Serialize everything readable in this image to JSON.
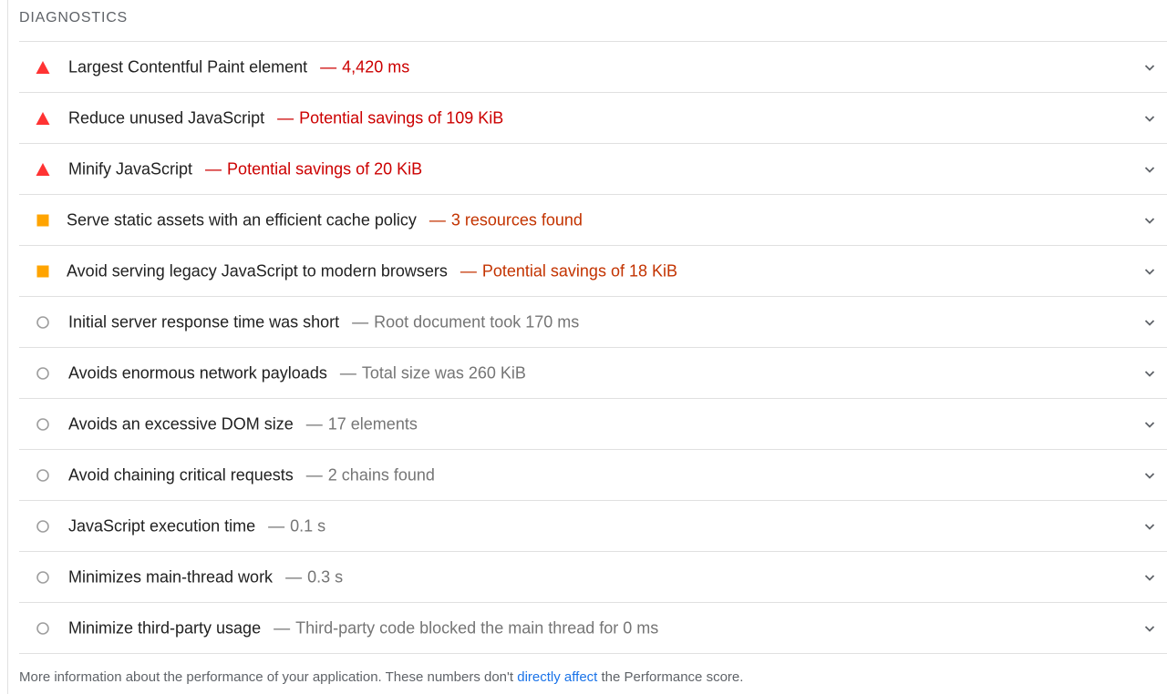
{
  "section": {
    "title": "DIAGNOSTICS"
  },
  "colors": {
    "fail": "#ff3333",
    "warn": "#ffa400",
    "info": "#9e9e9e",
    "link": "#1a73e8"
  },
  "audits": [
    {
      "status": "fail",
      "icon": "red-triangle-icon",
      "title": "Largest Contentful Paint element",
      "separator": "—",
      "value": "4,420 ms"
    },
    {
      "status": "fail",
      "icon": "red-triangle-icon",
      "title": "Reduce unused JavaScript",
      "separator": "—",
      "value": "Potential savings of 109 KiB"
    },
    {
      "status": "fail",
      "icon": "red-triangle-icon",
      "title": "Minify JavaScript",
      "separator": "—",
      "value": "Potential savings of 20 KiB"
    },
    {
      "status": "warn",
      "icon": "orange-square-icon",
      "title": "Serve static assets with an efficient cache policy",
      "separator": "—",
      "value": "3 resources found"
    },
    {
      "status": "warn",
      "icon": "orange-square-icon",
      "title": "Avoid serving legacy JavaScript to modern browsers",
      "separator": "—",
      "value": "Potential savings of 18 KiB"
    },
    {
      "status": "info",
      "icon": "gray-circle-icon",
      "title": "Initial server response time was short",
      "separator": "—",
      "value": "Root document took 170 ms"
    },
    {
      "status": "info",
      "icon": "gray-circle-icon",
      "title": "Avoids enormous network payloads",
      "separator": "—",
      "value": "Total size was 260 KiB"
    },
    {
      "status": "info",
      "icon": "gray-circle-icon",
      "title": "Avoids an excessive DOM size",
      "separator": "—",
      "value": "17 elements"
    },
    {
      "status": "info",
      "icon": "gray-circle-icon",
      "title": "Avoid chaining critical requests",
      "separator": "—",
      "value": "2 chains found"
    },
    {
      "status": "info",
      "icon": "gray-circle-icon",
      "title": "JavaScript execution time",
      "separator": "—",
      "value": "0.1 s"
    },
    {
      "status": "info",
      "icon": "gray-circle-icon",
      "title": "Minimizes main-thread work",
      "separator": "—",
      "value": "0.3 s"
    },
    {
      "status": "info",
      "icon": "gray-circle-icon",
      "title": "Minimize third-party usage",
      "separator": "—",
      "value": "Third-party code blocked the main thread for 0 ms"
    }
  ],
  "footer": {
    "before": "More information about the performance of your application. These numbers don't ",
    "link": "directly affect",
    "after": " the Performance score."
  }
}
